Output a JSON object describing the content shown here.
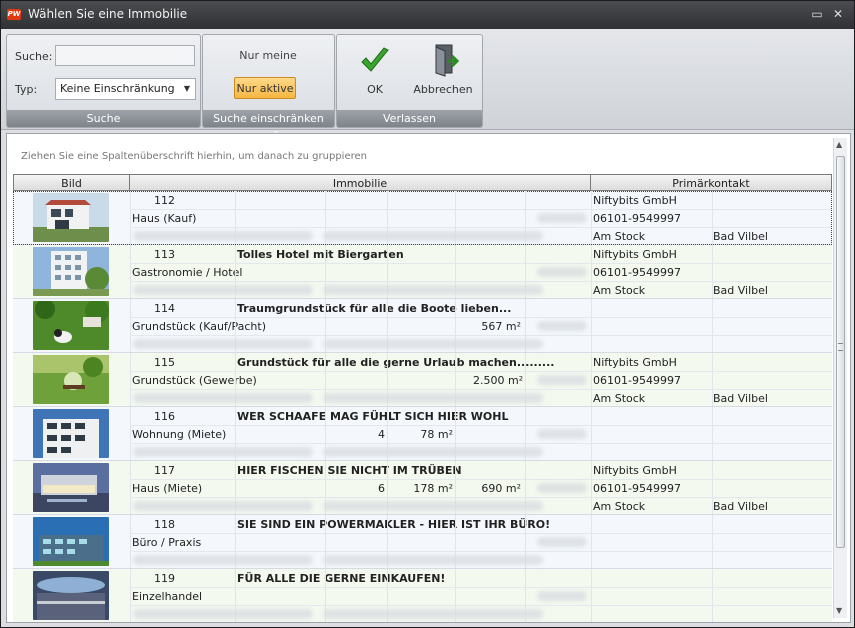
{
  "window": {
    "title": "Wählen Sie eine Immobilie",
    "logo_text": "PW",
    "minimize_glyph": "▭",
    "close_glyph": "✕"
  },
  "ribbon": {
    "search_group": {
      "search_label": "Suche:",
      "search_value": "",
      "type_label": "Typ:",
      "type_value": "Keine Einschränkung",
      "group_label": "Suche"
    },
    "restrict_group": {
      "only_mine": "Nur meine",
      "only_active": "Nur aktive",
      "group_label": "Suche einschränken auf"
    },
    "leave_group": {
      "ok": "OK",
      "cancel": "Abbrechen",
      "group_label": "Verlassen"
    }
  },
  "grid": {
    "group_hint": "Ziehen Sie eine Spaltenüberschrift hierhin, um danach zu gruppieren",
    "columns": [
      "Bild",
      "Immobilie",
      "Primärkontakt"
    ],
    "rows": [
      {
        "id": "112",
        "headline": "",
        "category": "Haus (Kauf)",
        "rooms": "",
        "area": "",
        "plot": "",
        "contact_company": "Niftybits GmbH",
        "contact_phone": "06101-9549997",
        "contact_street": "Am Stock",
        "contact_city": "Bad Vilbel"
      },
      {
        "id": "113",
        "headline": "Tolles Hotel mit Biergarten",
        "category": "Gastronomie / Hotel",
        "rooms": "",
        "area": "",
        "plot": "",
        "contact_company": "Niftybits GmbH",
        "contact_phone": "06101-9549997",
        "contact_street": "Am Stock",
        "contact_city": "Bad Vilbel"
      },
      {
        "id": "114",
        "headline": "Traumgrundstück für alle die Boote lieben...",
        "category": "Grundstück (Kauf/Pacht)",
        "rooms": "",
        "area": "",
        "plot": "567 m²",
        "contact_company": "",
        "contact_phone": "",
        "contact_street": "",
        "contact_city": ""
      },
      {
        "id": "115",
        "headline": "Grundstück für alle die gerne Urlaub machen.........",
        "category": "Grundstück (Gewerbe)",
        "rooms": "",
        "area": "",
        "plot": "2.500 m²",
        "contact_company": "Niftybits GmbH",
        "contact_phone": "06101-9549997",
        "contact_street": "Am Stock",
        "contact_city": "Bad Vilbel"
      },
      {
        "id": "116",
        "headline": "WER SCHAAFE MAG FÜHLT SICH HIER WOHL",
        "category": "Wohnung (Miete)",
        "rooms": "4",
        "area": "78 m²",
        "plot": "",
        "contact_company": "",
        "contact_phone": "",
        "contact_street": "",
        "contact_city": ""
      },
      {
        "id": "117",
        "headline": "HIER FISCHEN SIE NICHT IM TRÜBEN",
        "category": "Haus (Miete)",
        "rooms": "6",
        "area": "178 m²",
        "plot": "690 m²",
        "contact_company": "Niftybits GmbH",
        "contact_phone": "06101-9549997",
        "contact_street": "Am Stock",
        "contact_city": "Bad Vilbel"
      },
      {
        "id": "118",
        "headline": "SIE SIND EIN POWERMAKLER - HIER IST IHR BÜRO!",
        "category": "Büro / Praxis",
        "rooms": "",
        "area": "",
        "plot": "",
        "contact_company": "",
        "contact_phone": "",
        "contact_street": "",
        "contact_city": ""
      },
      {
        "id": "119",
        "headline": "FÜR ALLE DIE GERNE EINKAUFEN!",
        "category": "Einzelhandel",
        "rooms": "",
        "area": "",
        "plot": "",
        "contact_company": "",
        "contact_phone": "",
        "contact_street": "",
        "contact_city": ""
      }
    ]
  },
  "colors": {
    "active_button": "#f5b642",
    "title_bar": "#2f3134",
    "ok_check": "#3aa52e"
  }
}
